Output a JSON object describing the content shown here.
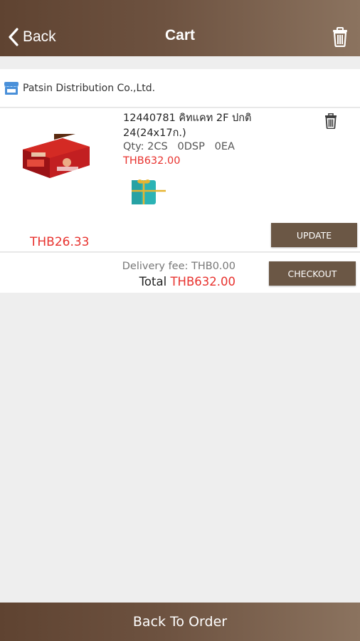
{
  "header": {
    "back_label": "Back",
    "title": "Cart",
    "trash_icon": "trash-icon"
  },
  "supplier": {
    "icon": "store-icon",
    "name": "Patsin Distribution Co.,Ltd."
  },
  "item": {
    "title": "12440781 คิทแคท 2F ปกติ 24(24x17ก.)",
    "qty": "Qty: 2CS   0DSP   0EA",
    "price": "THB632.00",
    "unit_price": "THB26.33",
    "gift_icon": "gift-icon",
    "update_label": "UPDATE"
  },
  "summary": {
    "delivery_fee": "Delivery fee: THB0.00",
    "total_label": "Total",
    "total_value": "THB632.00",
    "checkout_label": "CHECKOUT"
  },
  "footer": {
    "label": "Back To Order"
  },
  "colors": {
    "header_brown": "#6d5240",
    "button_brown": "#6b5745",
    "price_red": "#e8322e",
    "background": "#eeeeee"
  }
}
